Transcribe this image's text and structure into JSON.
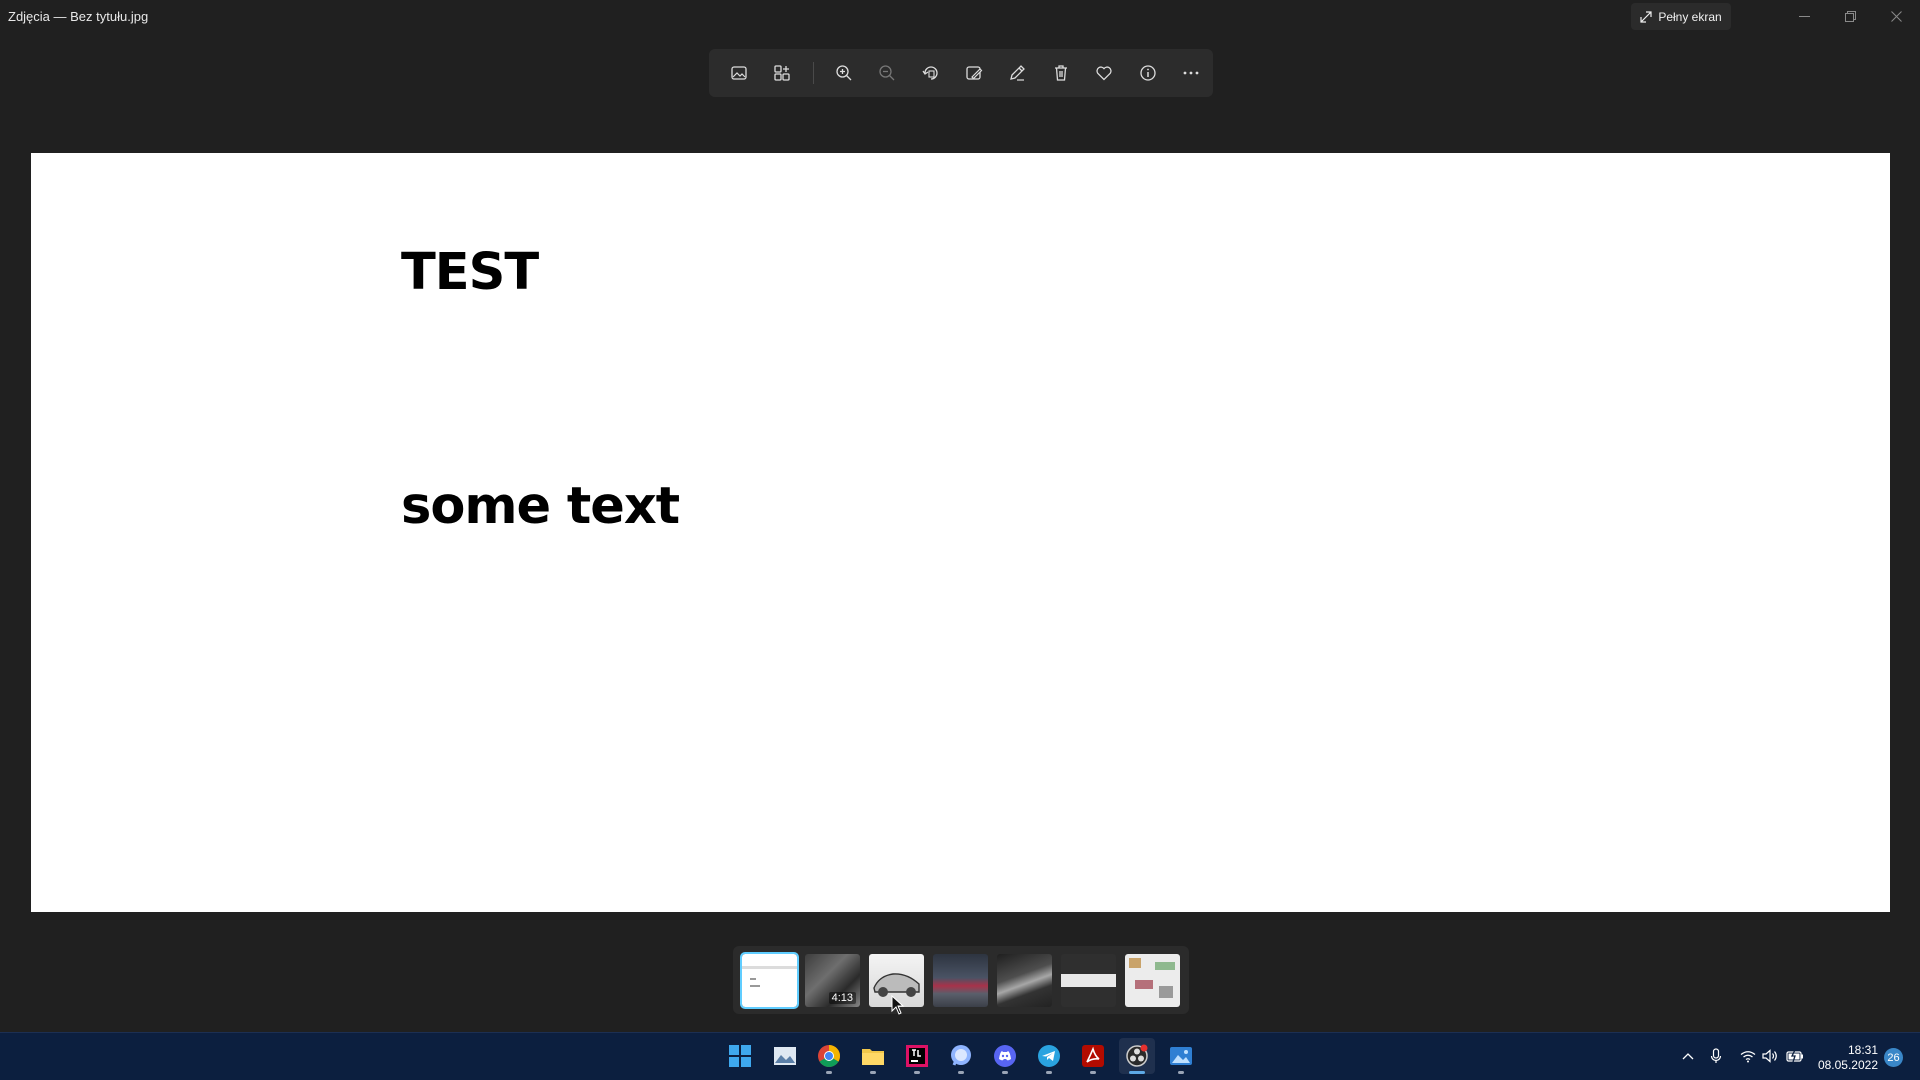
{
  "window": {
    "title": "Zdjęcia — Bez tytułu.jpg",
    "fullscreen_label": "Pełny ekran"
  },
  "toolbar": {
    "buttons": [
      "view-image-icon",
      "gallery-icon",
      "zoom-in-icon",
      "zoom-out-icon",
      "rotate-icon",
      "edit-image-icon",
      "draw-icon",
      "delete-icon",
      "favorite-icon",
      "info-icon",
      "more-icon"
    ]
  },
  "image": {
    "heading": "TEST",
    "body_text": "some text"
  },
  "filmstrip": {
    "video_duration": "4:13"
  },
  "taskbar": {
    "apps": [
      "start",
      "photos-gallery",
      "chrome",
      "file-explorer",
      "jetbrains",
      "messenger",
      "discord",
      "telegram",
      "acrobat",
      "obs",
      "photos"
    ],
    "time": "18:31",
    "date": "08.05.2022",
    "notification_count": "26"
  },
  "colors": {
    "background": "#202020",
    "accent": "#60cdff",
    "taskbar": "#0c1f3f"
  }
}
